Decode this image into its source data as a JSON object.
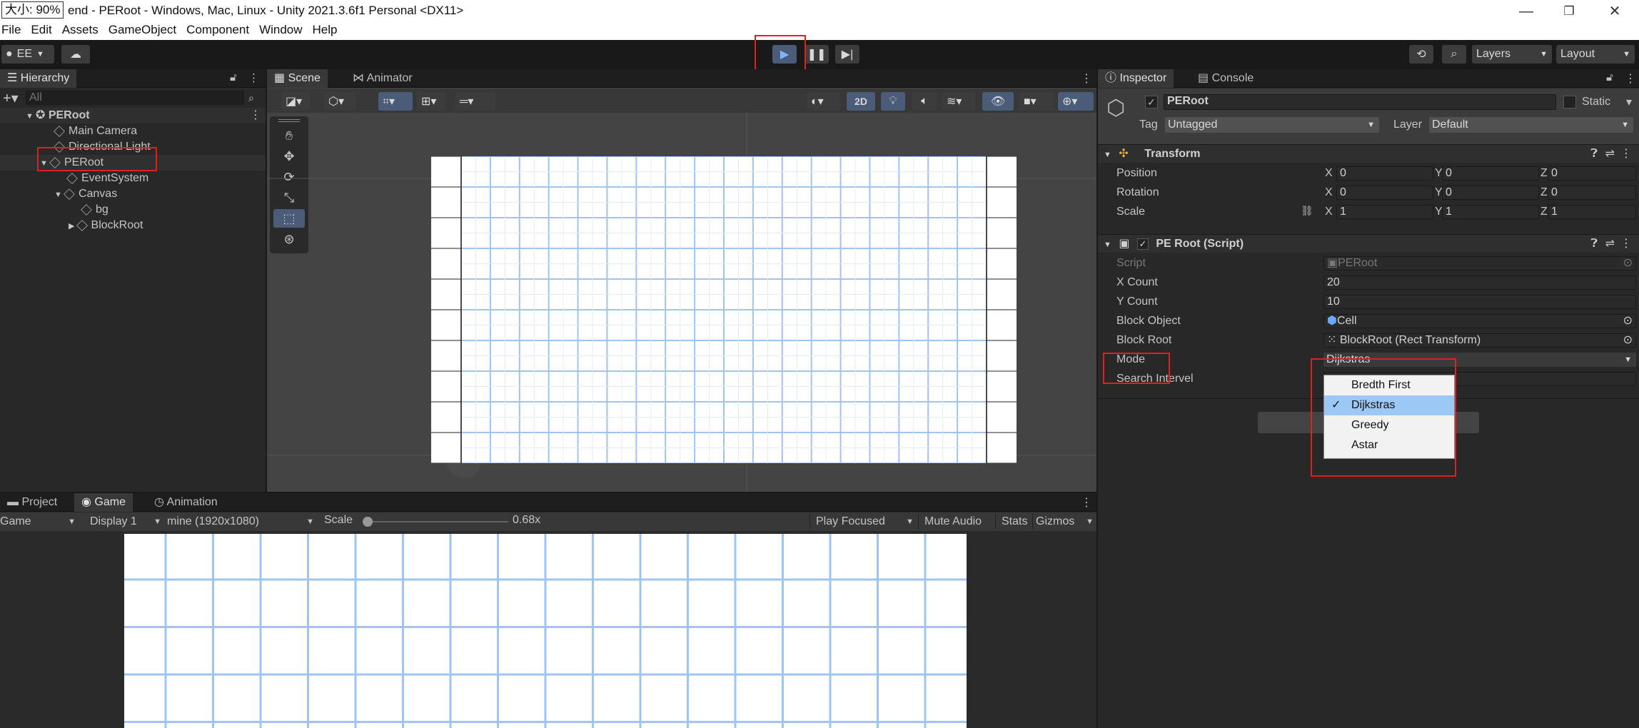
{
  "window": {
    "zoom_label": "大小: 90%",
    "title": "end - PERoot - Windows, Mac, Linux - Unity 2021.3.6f1 Personal <DX11>",
    "minimize": "—",
    "restore": "❐",
    "close": "✕"
  },
  "menu": [
    "File",
    "Edit",
    "Assets",
    "GameObject",
    "Component",
    "Window",
    "Help"
  ],
  "toolbar": {
    "account": "EE",
    "layers": "Layers",
    "layout": "Layout"
  },
  "hierarchy": {
    "tab": "Hierarchy",
    "search_placeholder": "All",
    "items": [
      {
        "label": "PERoot"
      },
      {
        "label": "Main Camera"
      },
      {
        "label": "Directional Light"
      },
      {
        "label": "PERoot"
      },
      {
        "label": "EventSystem"
      },
      {
        "label": "Canvas"
      },
      {
        "label": "bg"
      },
      {
        "label": "BlockRoot"
      }
    ]
  },
  "scene": {
    "tabs": [
      "Scene",
      "Animator"
    ],
    "btn_2d": "2D",
    "grid_cols": 18,
    "grid_rows": 10
  },
  "bottom": {
    "tabs": [
      "Project",
      "Game",
      "Animation"
    ],
    "game_dd": "Game",
    "display": "Display 1",
    "resolution": "mine (1920x1080)",
    "scale_label": "Scale",
    "scale_value": "0.68x",
    "play_focused": "Play Focused",
    "mute": "Mute Audio",
    "stats": "Stats",
    "gizmos": "Gizmos"
  },
  "inspector": {
    "tabs": [
      "Inspector",
      "Console"
    ],
    "object_name": "PERoot",
    "static_label": "Static",
    "tag_label": "Tag",
    "tag_value": "Untagged",
    "layer_label": "Layer",
    "layer_value": "Default",
    "transform": {
      "title": "Transform",
      "rows": [
        {
          "label": "Position",
          "x": "0",
          "y": "0",
          "z": "0"
        },
        {
          "label": "Rotation",
          "x": "0",
          "y": "0",
          "z": "0"
        },
        {
          "label": "Scale",
          "x": "1",
          "y": "1",
          "z": "1"
        }
      ],
      "axis": [
        "X",
        "Y",
        "Z"
      ]
    },
    "script": {
      "title": "PE Root (Script)",
      "rows": [
        {
          "label": "Script",
          "value": "PERoot"
        },
        {
          "label": "X Count",
          "value": "20"
        },
        {
          "label": "Y Count",
          "value": "10"
        },
        {
          "label": "Block Object",
          "value": "Cell"
        },
        {
          "label": "Block Root",
          "value": "BlockRoot (Rect Transform)"
        },
        {
          "label": "Mode",
          "value": "Dijkstras"
        },
        {
          "label": "Search Intervel",
          "value": ""
        }
      ]
    },
    "mode_options": [
      "Bredth First",
      "Dijkstras",
      "Greedy",
      "Astar"
    ],
    "mode_selected": "Dijkstras",
    "check": "✓"
  },
  "colors": {
    "accent": "#e02020",
    "grid": "#9fc4f0",
    "selection": "#9cc8f5"
  }
}
